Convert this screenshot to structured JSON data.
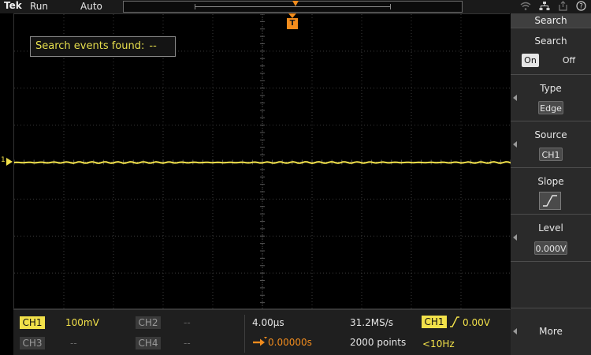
{
  "topbar": {
    "brand": "Tek",
    "state": "Run",
    "mode": "Auto"
  },
  "plot": {
    "search_box": {
      "label": "Search events found:",
      "value": "--"
    },
    "channel_marker": "1",
    "trigger_marker": "T",
    "trace_color": "#f2e14a",
    "trigger_color": "#f28c1d"
  },
  "panel": {
    "title": "Search",
    "search": {
      "label": "Search",
      "on": "On",
      "off": "Off"
    },
    "type": {
      "label": "Type",
      "value": "Edge"
    },
    "source": {
      "label": "Source",
      "value": "CH1"
    },
    "slope": {
      "label": "Slope",
      "icon": "rising-edge-icon"
    },
    "level": {
      "label": "Level",
      "value": "0.000V"
    }
  },
  "bottom": {
    "ch1": {
      "label": "CH1",
      "value": "100mV"
    },
    "ch2": {
      "label": "CH2",
      "value": "--"
    },
    "ch3": {
      "label": "CH3",
      "value": "--"
    },
    "ch4": {
      "label": "CH4",
      "value": "--"
    },
    "horizontal": {
      "scale": "4.00µs",
      "sample_rate": "31.2MS/s",
      "position": "0.00000s",
      "record_length": "2000 points"
    },
    "trigger": {
      "source": "CH1",
      "level": "0.00V",
      "frequency": "<10Hz"
    },
    "more": "More"
  }
}
